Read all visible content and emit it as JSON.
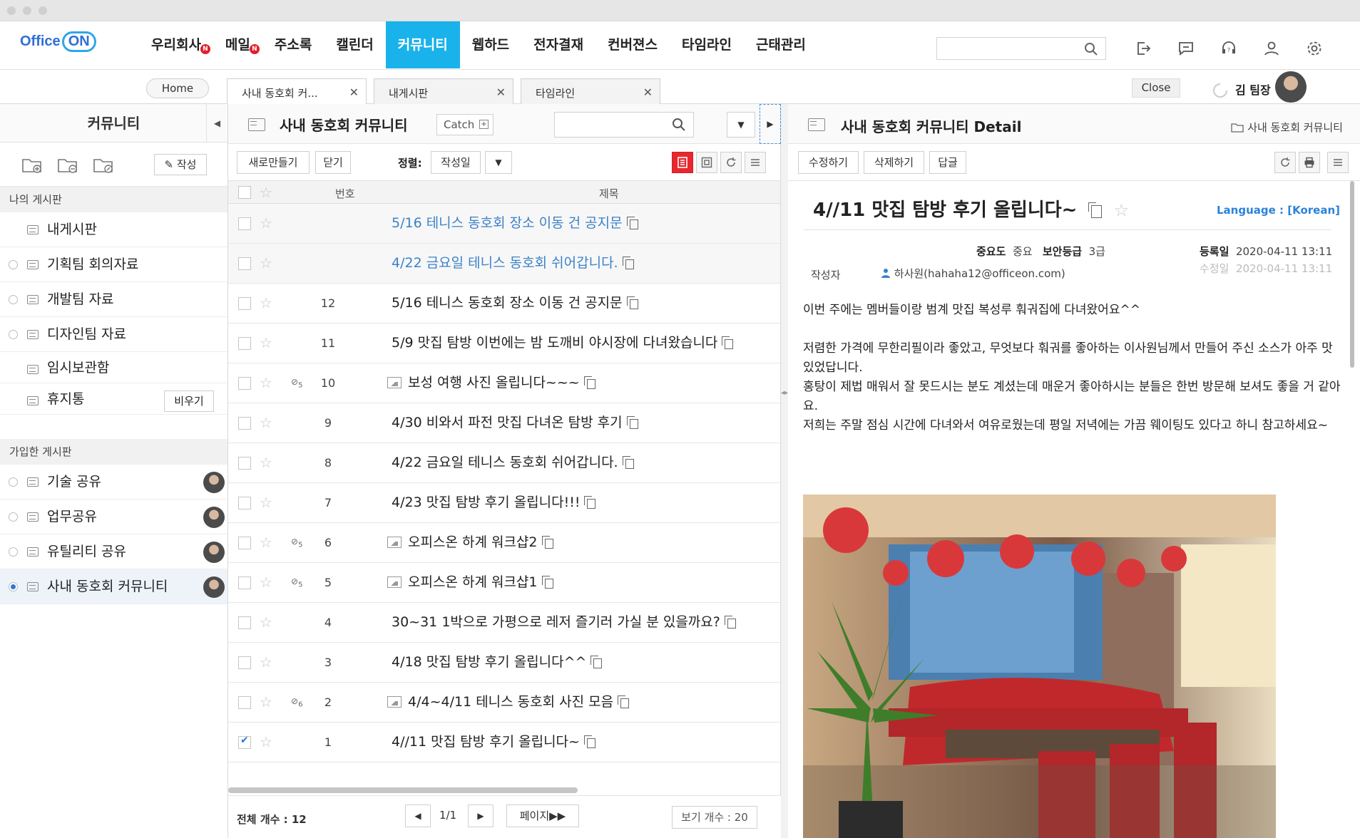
{
  "app": {
    "logo_text": "Office",
    "logo_on": "ON",
    "menu": [
      {
        "label": "우리회사",
        "badge": "N",
        "active": false
      },
      {
        "label": "메일",
        "badge": "N",
        "active": false
      },
      {
        "label": "주소록",
        "badge": "",
        "active": false
      },
      {
        "label": "캘린더",
        "badge": "",
        "active": false
      },
      {
        "label": "커뮤니티",
        "badge": "",
        "active": true
      },
      {
        "label": "웹하드",
        "badge": "",
        "active": false
      },
      {
        "label": "전자결재",
        "badge": "",
        "active": false
      },
      {
        "label": "컨버젼스",
        "badge": "",
        "active": false
      },
      {
        "label": "타임라인",
        "badge": "",
        "active": false
      },
      {
        "label": "근태관리",
        "badge": "",
        "active": false
      }
    ],
    "top_icons": [
      "logout-icon",
      "chat-icon",
      "support-icon",
      "user-icon",
      "settings-icon"
    ],
    "accent": "#1ab2ea"
  },
  "tabs": {
    "home": "Home",
    "items": [
      {
        "label": "사내 동호회 커...",
        "active": true
      },
      {
        "label": "내게시판",
        "active": false
      },
      {
        "label": "타임라인",
        "active": false
      }
    ],
    "close": "Close",
    "user_name": "김 팀장"
  },
  "sidebar": {
    "title": "커뮤니티",
    "write": "작성",
    "my_boards_header": "나의 게시판",
    "my_boards": [
      {
        "label": "내게시판",
        "radio": false
      },
      {
        "label": "기획팀 회의자료",
        "radio": true
      },
      {
        "label": "개발팀 자료",
        "radio": true
      },
      {
        "label": "디자인팀 자료",
        "radio": true
      },
      {
        "label": "임시보관함",
        "radio": false
      },
      {
        "label": "휴지통",
        "radio": false
      }
    ],
    "empty_trash": "비우기",
    "joined_header": "가입한 게시판",
    "joined_boards": [
      {
        "label": "기술 공유",
        "selected": false
      },
      {
        "label": "업무공유",
        "selected": false
      },
      {
        "label": "유틸리티 공유",
        "selected": false
      },
      {
        "label": "사내 동호회 커뮤니티",
        "selected": true
      }
    ]
  },
  "list": {
    "title": "사내 동호회 커뮤니티",
    "catch": "Catch",
    "new_btn": "새로만들기",
    "close_btn": "닫기",
    "sort_label": "정렬:",
    "sort_value": "작성일",
    "col_num": "번호",
    "col_subject": "제목",
    "rows": [
      {
        "num": "",
        "subject": "5/16 테니스 동호회 장소 이동 건 공지문",
        "notice": true,
        "image": false,
        "attach": "",
        "checked": false
      },
      {
        "num": "",
        "subject": "4/22 금요일 테니스 동호회 쉬어갑니다.",
        "notice": true,
        "image": false,
        "attach": "",
        "checked": false
      },
      {
        "num": "12",
        "subject": "5/16 테니스 동호회 장소 이동 건 공지문",
        "notice": false,
        "image": false,
        "attach": "",
        "checked": false
      },
      {
        "num": "11",
        "subject": "5/9 맛집 탐방 이번에는 밤 도깨비 야시장에 다녀왔습니다",
        "notice": false,
        "image": false,
        "attach": "",
        "checked": false
      },
      {
        "num": "10",
        "subject": "보성 여행 사진 올립니다~~~",
        "notice": false,
        "image": true,
        "attach": "5",
        "checked": false
      },
      {
        "num": "9",
        "subject": "4/30 비와서 파전 맛집 다녀온 탐방 후기",
        "notice": false,
        "image": false,
        "attach": "",
        "checked": false
      },
      {
        "num": "8",
        "subject": "4/22 금요일 테니스 동호회 쉬어갑니다.",
        "notice": false,
        "image": false,
        "attach": "",
        "checked": false
      },
      {
        "num": "7",
        "subject": "4/23 맛집 탐방 후기 올립니다!!!",
        "notice": false,
        "image": false,
        "attach": "",
        "checked": false
      },
      {
        "num": "6",
        "subject": "오피스온 하계 워크샵2",
        "notice": false,
        "image": true,
        "attach": "5",
        "checked": false
      },
      {
        "num": "5",
        "subject": "오피스온 하계 워크샵1",
        "notice": false,
        "image": true,
        "attach": "5",
        "checked": false
      },
      {
        "num": "4",
        "subject": "30~31 1박으로 가평으로 레저 즐기러 가실 분 있을까요?",
        "notice": false,
        "image": false,
        "attach": "",
        "checked": false
      },
      {
        "num": "3",
        "subject": "4/18 맛집 탐방 후기 올립니다^^",
        "notice": false,
        "image": false,
        "attach": "",
        "checked": false
      },
      {
        "num": "2",
        "subject": "4/4~4/11 테니스 동호회 사진 모음",
        "notice": false,
        "image": true,
        "attach": "6",
        "checked": false
      },
      {
        "num": "1",
        "subject": "4//11 맛집 탐방 후기 올립니다~",
        "notice": false,
        "image": false,
        "attach": "",
        "checked": true
      }
    ],
    "total": "전체 개수 : 12",
    "page": "1/1",
    "page_btn": "페이지▶▶",
    "per_page": "보기 개수 : 20"
  },
  "detail": {
    "header": "사내 동호회 커뮤니티 Detail",
    "path": "사내 동호회 커뮤니티",
    "edit": "수정하기",
    "delete": "삭제하기",
    "reply": "답글",
    "title": "4//11 맛집 탐방 후기 올립니다~",
    "language": "Language : [Korean]",
    "importance_label": "중요도",
    "importance": "중요",
    "security_label": "보안등급",
    "security": "3급",
    "reg_label": "등록일",
    "reg_date": "2020-04-11 13:11",
    "mod_label": "수정일",
    "mod_date": "2020-04-11 13:11",
    "author_label": "작성자",
    "author": "하사원(hahaha12@officeon.com)",
    "body": [
      "이번 주에는 멤버들이랑 범계 맛집 복성루 훠궈집에 다녀왔어요^^",
      "",
      "저렴한 가격에 무한리필이라 좋았고, 무엇보다 훠궈를 좋아하는 이사원님께서 만들어 주신 소스가 아주 맛있었답니다.",
      "홍탕이 제법 매워서 잘 못드시는 분도 계셨는데 매운거 좋아하시는 분들은 한번 방문해 보셔도 좋을 거 같아요.",
      "저희는 주말 점심 시간에 다녀와서 여유로웠는데 평일 저녁에는 가끔 웨이팅도 있다고 하니 참고하세요~"
    ]
  }
}
